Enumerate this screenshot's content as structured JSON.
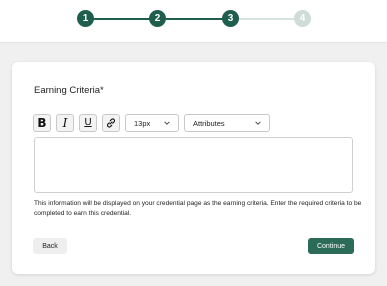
{
  "stepper": {
    "steps": [
      {
        "label": "1",
        "state": "done"
      },
      {
        "label": "2",
        "state": "done"
      },
      {
        "label": "3",
        "state": "done"
      },
      {
        "label": "4",
        "state": "todo"
      }
    ],
    "colors": {
      "done": "#1f5e4d",
      "todo": "#cfdcd8"
    }
  },
  "form": {
    "title": "Earning Criteria*",
    "toolbar": {
      "bold": "B",
      "italic": "I",
      "underline": "U",
      "link_icon": "link-icon",
      "font_size": "13px",
      "attributes": "Attributes"
    },
    "editor_value": "",
    "help_text": "This information will be displayed on your credential page as the earning criteria. Enter the required criteria to be completed to earn this credential."
  },
  "actions": {
    "back_label": "Back",
    "continue_label": "Continue"
  }
}
